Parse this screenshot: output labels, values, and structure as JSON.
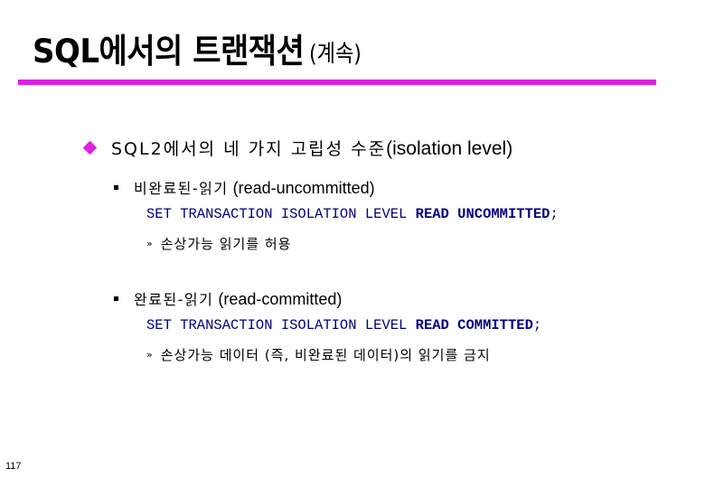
{
  "slide": {
    "title_main": "SQL에서의 트랜잭션",
    "title_sub": "(계속)",
    "accent_color": "#e020e0",
    "page_number": "117"
  },
  "bullets": {
    "level1": {
      "icon": "diamond-icon",
      "text_ko": "SQL2에서의 네 가지 고립성 수준",
      "text_en": "(isolation level)"
    },
    "items": [
      {
        "icon": "square-bullet-icon",
        "label_ko": "비완료된-읽기",
        "label_en": "(read-uncommitted)",
        "code_prefix": "SET TRANSACTION ISOLATION LEVEL ",
        "code_keyword": "READ UNCOMMITTED",
        "code_suffix": ";",
        "note_marker": "»",
        "note": "손상가능 읽기를 허용"
      },
      {
        "icon": "square-bullet-icon",
        "label_ko": "완료된-읽기",
        "label_en": "(read-committed)",
        "code_prefix": "SET TRANSACTION ISOLATION LEVEL ",
        "code_keyword": "READ COMMITTED",
        "code_suffix": ";",
        "note_marker": "»",
        "note": "손상가능 데이터 (즉, 비완료된 데이터)의 읽기를 금지"
      }
    ]
  }
}
